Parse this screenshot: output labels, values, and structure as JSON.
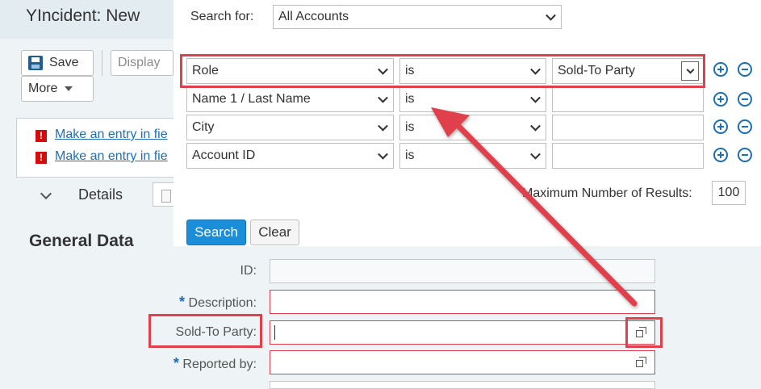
{
  "app": {
    "title": "YIncident: New"
  },
  "toolbar": {
    "save_label": "Save",
    "display_label": "Display",
    "more_label": "More"
  },
  "messages": [
    {
      "text": "Make an entry in fie"
    },
    {
      "text": "Make an entry in fie"
    }
  ],
  "details": {
    "label": "Details"
  },
  "section": {
    "title": "General Data"
  },
  "search": {
    "search_for_label": "Search for:",
    "search_for_value": "All Accounts",
    "criteria": [
      {
        "field": "Role",
        "operator": "is",
        "value": "Sold-To Party"
      },
      {
        "field": "Name 1 / Last Name",
        "operator": "is",
        "value": ""
      },
      {
        "field": "City",
        "operator": "is",
        "value": ""
      },
      {
        "field": "Account ID",
        "operator": "is",
        "value": ""
      }
    ],
    "max_results_label": "Maximum Number of Results:",
    "max_results_value": "100",
    "search_button": "Search",
    "clear_button": "Clear"
  },
  "form": {
    "id_label": "ID:",
    "description_label": "Description:",
    "sold_to_label": "Sold-To Party:",
    "reported_by_label": "Reported by:",
    "required_mark": "*"
  },
  "colors": {
    "annotation": "#e0404c",
    "accent": "#1b8ed9",
    "link": "#1e6fb8",
    "error": "#d70b0b"
  }
}
